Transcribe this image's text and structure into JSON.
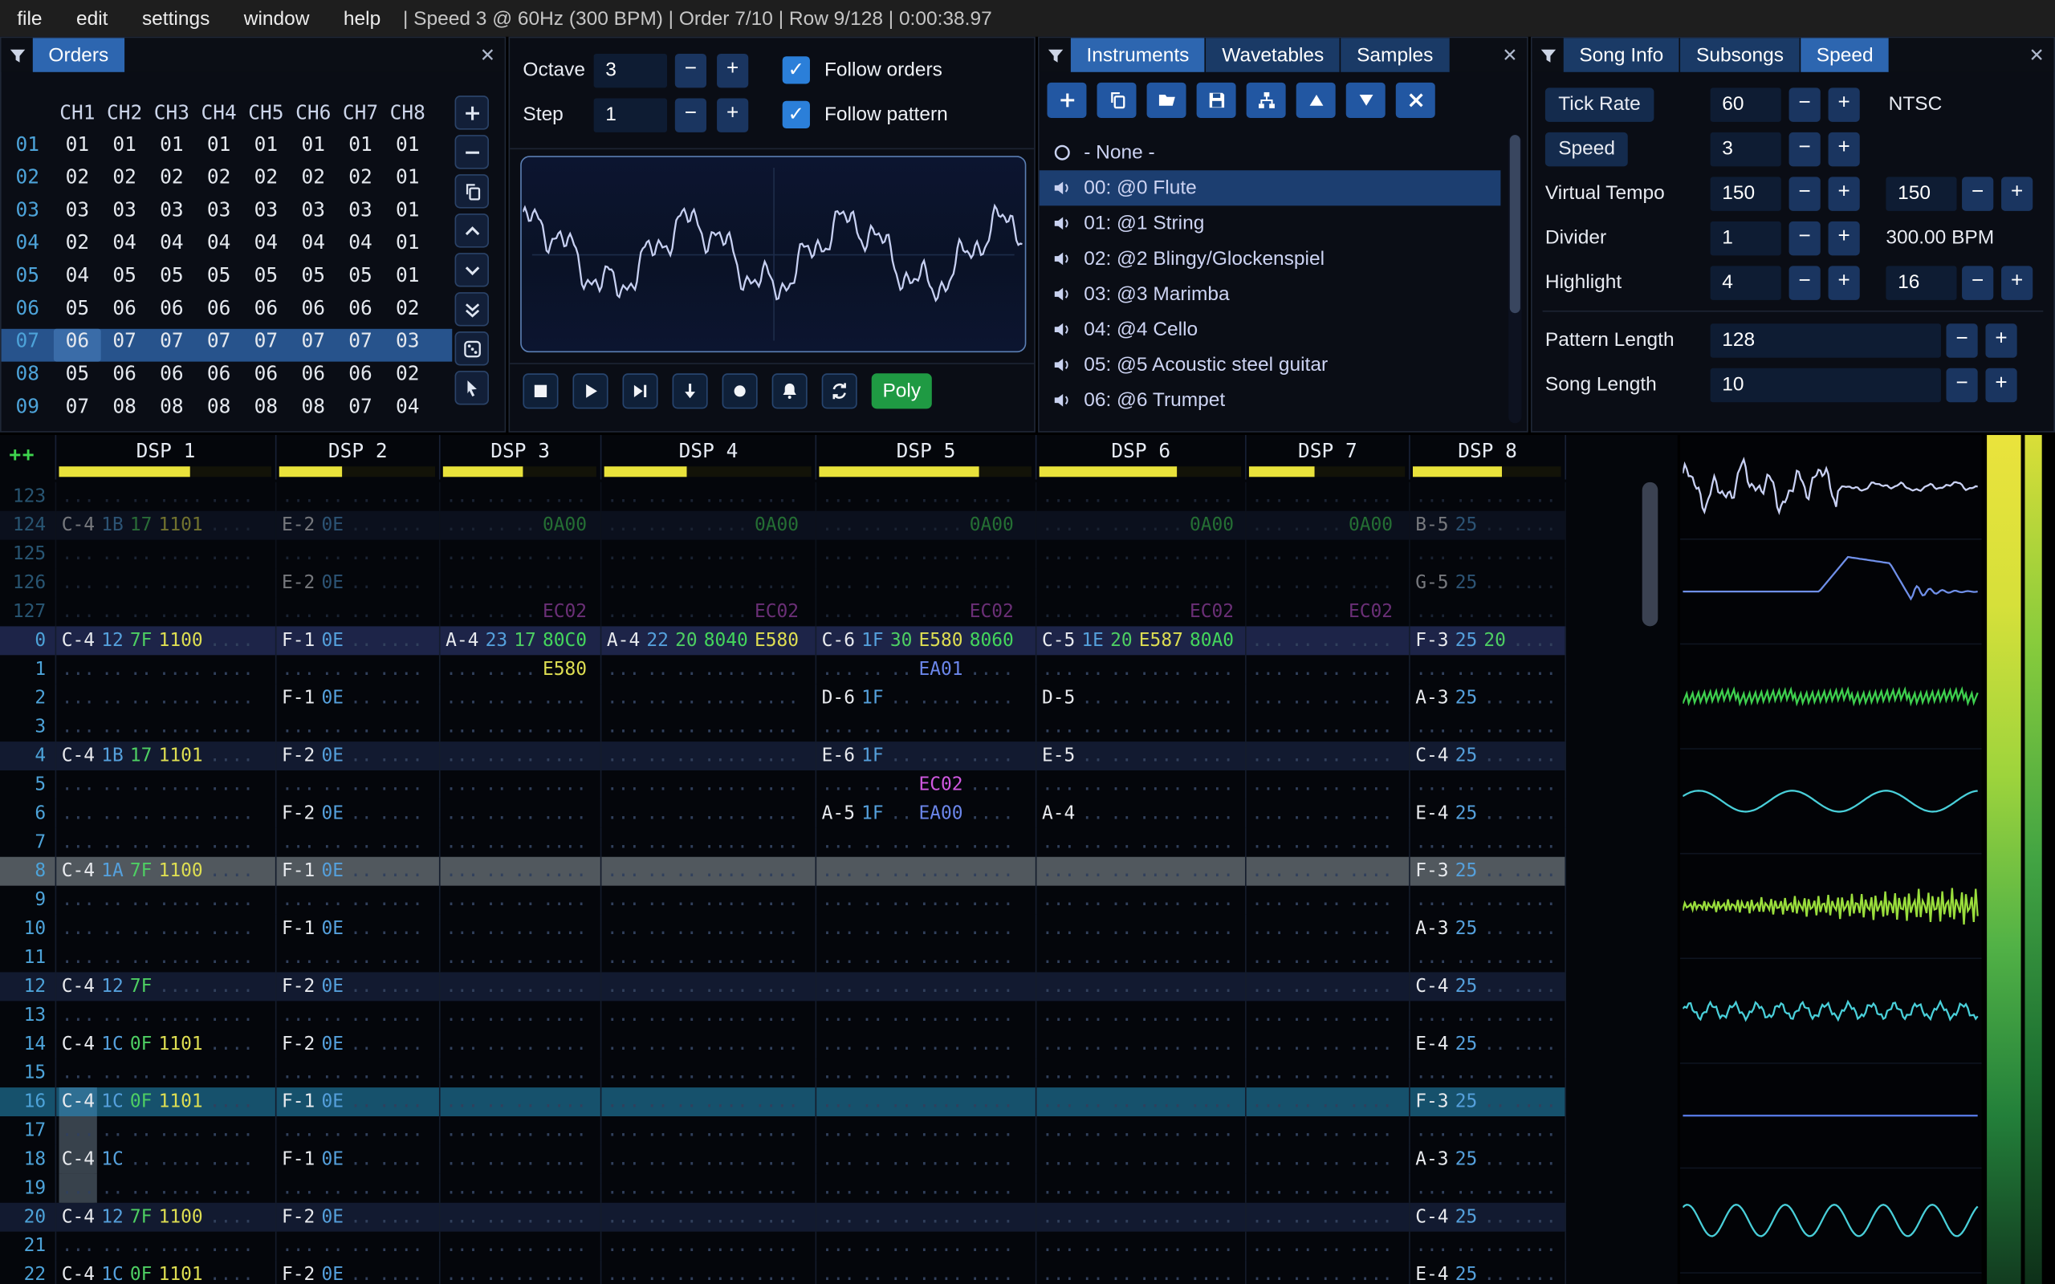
{
  "menu": {
    "items": [
      "file",
      "edit",
      "settings",
      "window",
      "help"
    ],
    "status": "| Speed 3 @ 60Hz (300 BPM) | Order 7/10 | Row 9/128 | 0:00:38.97"
  },
  "orders": {
    "title": "Orders",
    "col_headers": [
      "CH1",
      "CH2",
      "CH3",
      "CH4",
      "CH5",
      "CH6",
      "CH7",
      "CH8"
    ],
    "current": "07",
    "rows": [
      {
        "n": "01",
        "v": [
          "01",
          "01",
          "01",
          "01",
          "01",
          "01",
          "01",
          "01"
        ]
      },
      {
        "n": "02",
        "v": [
          "02",
          "02",
          "02",
          "02",
          "02",
          "02",
          "02",
          "01"
        ]
      },
      {
        "n": "03",
        "v": [
          "03",
          "03",
          "03",
          "03",
          "03",
          "03",
          "03",
          "01"
        ]
      },
      {
        "n": "04",
        "v": [
          "02",
          "04",
          "04",
          "04",
          "04",
          "04",
          "04",
          "01"
        ]
      },
      {
        "n": "05",
        "v": [
          "04",
          "05",
          "05",
          "05",
          "05",
          "05",
          "05",
          "01"
        ]
      },
      {
        "n": "06",
        "v": [
          "05",
          "06",
          "06",
          "06",
          "06",
          "06",
          "06",
          "02"
        ]
      },
      {
        "n": "07",
        "v": [
          "06",
          "07",
          "07",
          "07",
          "07",
          "07",
          "07",
          "03"
        ]
      },
      {
        "n": "08",
        "v": [
          "05",
          "06",
          "06",
          "06",
          "06",
          "06",
          "06",
          "02"
        ]
      },
      {
        "n": "09",
        "v": [
          "07",
          "08",
          "08",
          "08",
          "08",
          "08",
          "07",
          "04"
        ]
      }
    ]
  },
  "controls": {
    "octave_label": "Octave",
    "octave": "3",
    "step_label": "Step",
    "step": "1",
    "follow_orders": "Follow orders",
    "follow_pattern": "Follow pattern",
    "poly": "Poly"
  },
  "osc": {
    "color": "#c7d0f2"
  },
  "instruments": {
    "tabs": [
      "Instruments",
      "Wavetables",
      "Samples"
    ],
    "active_tab": "Instruments",
    "none_item": "- None -",
    "selected": 0,
    "items": [
      "00: @0 Flute",
      "01: @1 String",
      "02: @2 Blingy/Glockenspiel",
      "03: @3 Marimba",
      "04: @4 Cello",
      "05: @5 Acoustic steel guitar",
      "06: @6 Trumpet"
    ]
  },
  "song": {
    "tabs": [
      "Song Info",
      "Subsongs",
      "Speed"
    ],
    "active_tab": "Speed",
    "fields": {
      "tick_rate_label": "Tick Rate",
      "tick_rate": "60",
      "tick_rate_unit": "NTSC",
      "speed_label": "Speed",
      "speed": "3",
      "virtual_tempo_label": "Virtual Tempo",
      "virtual_tempo_num": "150",
      "virtual_tempo_den": "150",
      "divider_label": "Divider",
      "divider": "1",
      "bpm": "300.00 BPM",
      "highlight_label": "Highlight",
      "highlight_first": "4",
      "highlight_second": "16",
      "pattern_length_label": "Pattern Length",
      "pattern_length": "128",
      "song_length_label": "Song Length",
      "song_length": "10"
    }
  },
  "pattern": {
    "corner": "++",
    "channels": [
      {
        "label": "DSP 1",
        "w": 168,
        "fx": 2,
        "vu": 0.62
      },
      {
        "label": "DSP 2",
        "w": 125,
        "fx": 1,
        "vu": 0.4
      },
      {
        "label": "DSP 3",
        "w": 123,
        "fx": 1,
        "vu": 0.52
      },
      {
        "label": "DSP 4",
        "w": 164,
        "fx": 2,
        "vu": 0.4
      },
      {
        "label": "DSP 5",
        "w": 168,
        "fx": 2,
        "vu": 0.75
      },
      {
        "label": "DSP 6",
        "w": 160,
        "fx": 2,
        "vu": 0.68
      },
      {
        "label": "DSP 7",
        "w": 125,
        "fx": 1,
        "vu": 0.42
      },
      {
        "label": "DSP 8",
        "w": 120,
        "fx": 1,
        "vu": 0.6
      }
    ],
    "rows": [
      {
        "n": "123",
        "cls": "prev",
        "c": [
          null,
          null,
          null,
          null,
          null,
          null,
          null,
          null
        ]
      },
      {
        "n": "124",
        "cls": "prev hl1",
        "c": [
          [
            "C-4~n",
            "1B~i",
            "17~v",
            "1101~fy",
            "....~d"
          ],
          [
            "E-2~n",
            "0E~i",
            "..~d",
            "....~d"
          ],
          [
            "...~d",
            "..~d",
            "..~d",
            "0A00~fg"
          ],
          [
            "...~d",
            "..~d",
            "..~d",
            "....~d",
            "0A00~fg"
          ],
          [
            "...~d",
            "..~d",
            "..~d",
            "....~d",
            "0A00~fg"
          ],
          [
            "...~d",
            "..~d",
            "..~d",
            "....~d",
            "0A00~fg"
          ],
          [
            "...~d",
            "..~d",
            "..~d",
            "0A00~fg"
          ],
          [
            "B-5~n",
            "25~i",
            "..~d",
            "....~d"
          ]
        ]
      },
      {
        "n": "125",
        "cls": "prev",
        "c": [
          null,
          null,
          null,
          null,
          null,
          null,
          null,
          null
        ]
      },
      {
        "n": "126",
        "cls": "prev",
        "c": [
          null,
          [
            "E-2~n",
            "0E~i",
            "..~d",
            "....~d"
          ],
          null,
          null,
          null,
          null,
          null,
          [
            "G-5~n",
            "25~i",
            "..~d",
            "....~d"
          ]
        ]
      },
      {
        "n": "127",
        "cls": "prev",
        "c": [
          null,
          null,
          [
            "...~d",
            "..~d",
            "..~d",
            "EC02~fp"
          ],
          [
            "...~d",
            "..~d",
            "..~d",
            "....~d",
            "EC02~fp"
          ],
          [
            "...~d",
            "..~d",
            "..~d",
            "....~d",
            "EC02~fp"
          ],
          [
            "...~d",
            "..~d",
            "..~d",
            "....~d",
            "EC02~fp"
          ],
          [
            "...~d",
            "..~d",
            "..~d",
            "EC02~fp"
          ],
          null
        ]
      },
      {
        "n": "0",
        "cls": "hl2",
        "c": [
          [
            "C-4~n",
            "12~i",
            "7F~v",
            "1100~fy",
            "....~d"
          ],
          [
            "F-1~n",
            "0E~i",
            "..~d",
            "....~d"
          ],
          [
            "A-4~n",
            "23~i",
            "17~v",
            "80C0~fg"
          ],
          [
            "A-4~n",
            "22~i",
            "20~v",
            "8040~fg",
            "E580~fy"
          ],
          [
            "C-6~n",
            "1F~i",
            "30~v",
            "E580~fy",
            "8060~fg"
          ],
          [
            "C-5~n",
            "1E~i",
            "20~v",
            "E587~fy",
            "80A0~fg"
          ],
          null,
          [
            "F-3~n",
            "25~i",
            "20~v",
            "....~d"
          ]
        ]
      },
      {
        "n": "1",
        "c": [
          null,
          null,
          [
            "...~d",
            "..~d",
            "..~d",
            "E580~fy"
          ],
          null,
          [
            "...~d",
            "..~d",
            "..~d",
            "EA01~fb",
            "....~d"
          ],
          null,
          null,
          null
        ]
      },
      {
        "n": "2",
        "c": [
          null,
          [
            "F-1~n",
            "0E~i",
            "..~d",
            "....~d"
          ],
          null,
          null,
          [
            "D-6~n",
            "1F~i",
            "..~d",
            "....~d",
            "....~d"
          ],
          [
            "D-5~n",
            "..~d",
            "..~d",
            "....~d",
            "....~d"
          ],
          null,
          [
            "A-3~n",
            "25~i",
            "..~d",
            "....~d"
          ]
        ]
      },
      {
        "n": "3",
        "c": [
          null,
          null,
          null,
          null,
          null,
          null,
          null,
          null
        ]
      },
      {
        "n": "4",
        "cls": "hl1",
        "c": [
          [
            "C-4~n",
            "1B~i",
            "17~v",
            "1101~fy",
            "....~d"
          ],
          [
            "F-2~n",
            "0E~i",
            "..~d",
            "....~d"
          ],
          null,
          null,
          [
            "E-6~n",
            "1F~i",
            "..~d",
            "....~d",
            "....~d"
          ],
          [
            "E-5~n",
            "..~d",
            "..~d",
            "....~d",
            "....~d"
          ],
          null,
          [
            "C-4~n",
            "25~i",
            "..~d",
            "....~d"
          ]
        ]
      },
      {
        "n": "5",
        "c": [
          null,
          null,
          null,
          null,
          [
            "...~d",
            "..~d",
            "..~d",
            "EC02~fp",
            "....~d"
          ],
          null,
          null,
          null
        ]
      },
      {
        "n": "6",
        "c": [
          null,
          [
            "F-2~n",
            "0E~i",
            "..~d",
            "....~d"
          ],
          null,
          null,
          [
            "A-5~n",
            "1F~i",
            "..~d",
            "EA00~fb",
            "....~d"
          ],
          [
            "A-4~n",
            "..~d",
            "..~d",
            "....~d",
            "....~d"
          ],
          null,
          [
            "E-4~n",
            "25~i",
            "..~d",
            "....~d"
          ]
        ]
      },
      {
        "n": "7",
        "c": [
          null,
          null,
          null,
          null,
          null,
          null,
          null,
          null
        ]
      },
      {
        "n": "8",
        "cls": "hl1 play",
        "c": [
          [
            "C-4~n",
            "1A~i",
            "7F~v",
            "1100~fy",
            "....~d"
          ],
          [
            "F-1~n",
            "0E~i",
            "..~d",
            "....~d"
          ],
          null,
          null,
          null,
          null,
          null,
          [
            "F-3~n",
            "25~i",
            "..~d",
            "....~d"
          ]
        ]
      },
      {
        "n": "9",
        "c": [
          null,
          null,
          null,
          null,
          null,
          null,
          null,
          null
        ]
      },
      {
        "n": "10",
        "c": [
          null,
          [
            "F-1~n",
            "0E~i",
            "..~d",
            "....~d"
          ],
          null,
          null,
          null,
          null,
          null,
          [
            "A-3~n",
            "25~i",
            "..~d",
            "....~d"
          ]
        ]
      },
      {
        "n": "11",
        "c": [
          null,
          null,
          null,
          null,
          null,
          null,
          null,
          null
        ]
      },
      {
        "n": "12",
        "cls": "hl1",
        "c": [
          [
            "C-4~n",
            "12~i",
            "7F~v",
            "....~d",
            "....~d"
          ],
          [
            "F-2~n",
            "0E~i",
            "..~d",
            "....~d"
          ],
          null,
          null,
          null,
          null,
          null,
          [
            "C-4~n",
            "25~i",
            "..~d",
            "....~d"
          ]
        ]
      },
      {
        "n": "13",
        "c": [
          null,
          null,
          null,
          null,
          null,
          null,
          null,
          null
        ]
      },
      {
        "n": "14",
        "c": [
          [
            "C-4~n",
            "1C~i",
            "0F~v",
            "1101~fy",
            "....~d"
          ],
          [
            "F-2~n",
            "0E~i",
            "..~d",
            "....~d"
          ],
          null,
          null,
          null,
          null,
          null,
          [
            "E-4~n",
            "25~i",
            "..~d",
            "....~d"
          ]
        ]
      },
      {
        "n": "15",
        "c": [
          null,
          null,
          null,
          null,
          null,
          null,
          null,
          null
        ]
      },
      {
        "n": "16",
        "cls": "cur",
        "cur": 0,
        "c": [
          [
            "C-4~n",
            "1C~i",
            "0F~v",
            "1101~fy",
            "....~d"
          ],
          [
            "F-1~n",
            "0E~i",
            "..~d",
            "....~d"
          ],
          null,
          null,
          null,
          null,
          null,
          [
            "F-3~n",
            "25~i",
            "..~d",
            "....~d"
          ]
        ]
      },
      {
        "n": "17",
        "sel": [
          0
        ],
        "c": [
          [
            "...~d",
            "..~d",
            "..~d",
            "....~d",
            "....~d"
          ],
          null,
          null,
          null,
          null,
          null,
          null,
          null
        ]
      },
      {
        "n": "18",
        "sel": [
          0
        ],
        "c": [
          [
            "C-4~n",
            "1C~i",
            "..~d",
            "....~d",
            "....~d"
          ],
          [
            "F-1~n",
            "0E~i",
            "..~d",
            "....~d"
          ],
          null,
          null,
          null,
          null,
          null,
          [
            "A-3~n",
            "25~i",
            "..~d",
            "....~d"
          ]
        ]
      },
      {
        "n": "19",
        "sel": [
          0
        ],
        "c": [
          [
            "...~d",
            "..~d",
            "..~d",
            "....~d",
            "....~d"
          ],
          null,
          null,
          null,
          null,
          null,
          null,
          null
        ]
      },
      {
        "n": "20",
        "cls": "hl1",
        "c": [
          [
            "C-4~n",
            "12~i",
            "7F~v",
            "1100~fy",
            "....~d"
          ],
          [
            "F-2~n",
            "0E~i",
            "..~d",
            "....~d"
          ],
          null,
          null,
          null,
          null,
          null,
          [
            "C-4~n",
            "25~i",
            "..~d",
            "....~d"
          ]
        ]
      },
      {
        "n": "21",
        "c": [
          null,
          null,
          null,
          null,
          null,
          null,
          null,
          null
        ]
      },
      {
        "n": "22",
        "c": [
          [
            "C-4~n",
            "1C~i",
            "0F~v",
            "1101~fy",
            "....~d"
          ],
          [
            "F-2~n",
            "0E~i",
            "..~d",
            "....~d"
          ],
          null,
          null,
          null,
          null,
          null,
          [
            "E-4~n",
            "25~i",
            "..~d",
            "....~d"
          ]
        ]
      }
    ]
  },
  "scopes": [
    {
      "shape": "flute",
      "color": "#c9d1f4"
    },
    {
      "shape": "pulse",
      "color": "#6f8fe8"
    },
    {
      "shape": "densesaw",
      "color": "#3ecf4e"
    },
    {
      "shape": "sine3",
      "color": "#49cfd9"
    },
    {
      "shape": "densez",
      "color": "#9ade3c"
    },
    {
      "shape": "ripple",
      "color": "#49cfd9"
    },
    {
      "shape": "flat",
      "color": "#5577e0"
    },
    {
      "shape": "sine6",
      "color": "#49cfd9"
    }
  ],
  "meters": {
    "left": [
      "#eae33c",
      "#d6e03a",
      "#9ed43c",
      "#52b246",
      "#23803a",
      "#123c20"
    ],
    "right": [
      "#dade38",
      "#86cb3c",
      "#42a443",
      "#1d7031",
      "#0e3019"
    ]
  }
}
